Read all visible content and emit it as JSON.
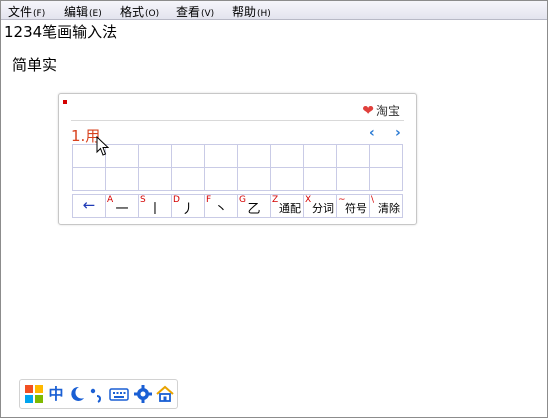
{
  "menu": {
    "items": [
      {
        "label": "文件",
        "accel": "(F)"
      },
      {
        "label": "编辑",
        "accel": "(E)"
      },
      {
        "label": "格式",
        "accel": "(O)"
      },
      {
        "label": "查看",
        "accel": "(V)"
      },
      {
        "label": "帮助",
        "accel": "(H)"
      }
    ]
  },
  "document": {
    "line1": "1234笔画输入法",
    "line2": "简单实"
  },
  "ime": {
    "taobao_label": "淘宝",
    "candidate": "1.用",
    "prev_glyph": "‹",
    "next_glyph": "›",
    "keys": [
      {
        "letter": "",
        "glyph": "←"
      },
      {
        "letter": "A",
        "glyph": "一"
      },
      {
        "letter": "S",
        "glyph": "丨"
      },
      {
        "letter": "D",
        "glyph": "丿"
      },
      {
        "letter": "F",
        "glyph": "丶"
      },
      {
        "letter": "G",
        "glyph": "乙"
      },
      {
        "letter": "Z",
        "glyph": "通配"
      },
      {
        "letter": "X",
        "glyph": "分词"
      },
      {
        "letter": "~",
        "glyph": "符号"
      },
      {
        "letter": "\\",
        "glyph": "清除"
      }
    ]
  },
  "status_bar": {
    "mode_label": "中",
    "icons": [
      "windows-logo-icon",
      "chinese-mode-icon",
      "moon-icon",
      "punctuation-icon",
      "keyboard-icon",
      "gear-icon",
      "home-icon"
    ]
  },
  "colors": {
    "accent_blue": "#1a5fd4",
    "candidate_red": "#d8411d",
    "key_letter_red": "#d40000"
  }
}
